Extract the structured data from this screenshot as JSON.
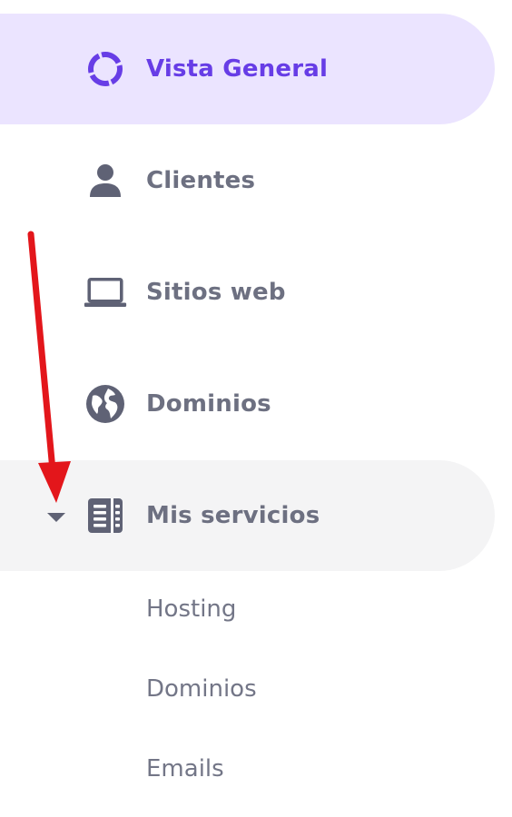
{
  "nav": {
    "items": [
      {
        "label": "Vista General",
        "icon": "overview-icon",
        "active": true
      },
      {
        "label": "Clientes",
        "icon": "user-icon"
      },
      {
        "label": "Sitios web",
        "icon": "laptop-icon"
      },
      {
        "label": "Dominios",
        "icon": "globe-icon"
      },
      {
        "label": "Mis servicios",
        "icon": "services-icon",
        "expanded": true
      }
    ],
    "subitems": [
      {
        "label": "Hosting"
      },
      {
        "label": "Dominios"
      },
      {
        "label": "Emails"
      }
    ]
  },
  "colors": {
    "active_bg": "#ebe4ff",
    "active_text": "#673de6",
    "expanded_bg": "#f4f4f5",
    "text": "#6d7081",
    "annotation_arrow": "#e3161b"
  }
}
